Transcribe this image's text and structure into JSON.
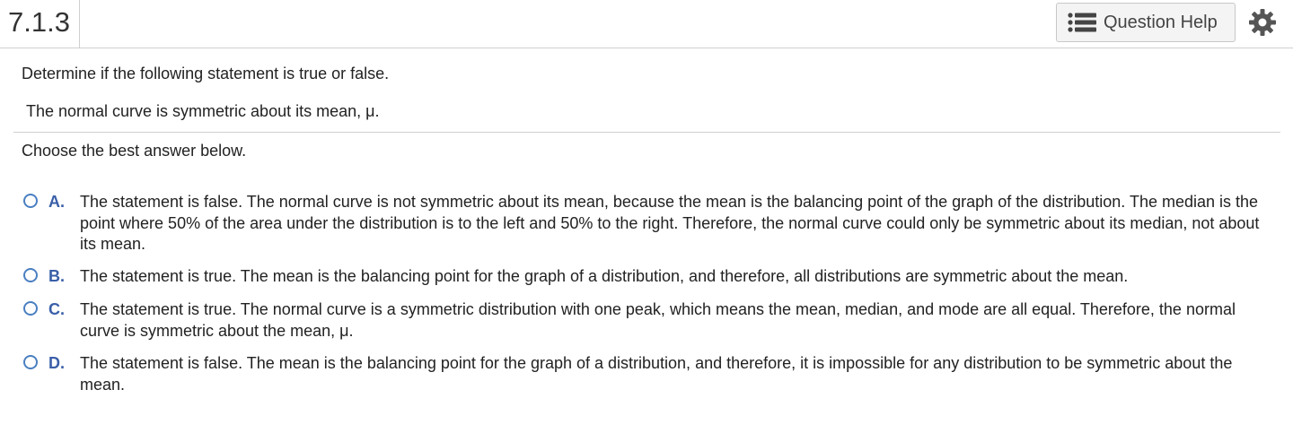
{
  "header": {
    "question_number": "7.1.3",
    "help_label": "Question Help",
    "help_icon": "list-icon",
    "settings_icon": "gear-icon"
  },
  "question": {
    "prompt": "Determine if the following statement is true or false.",
    "statement": "The normal curve is symmetric about its mean, μ.",
    "instruction": "Choose the best answer below."
  },
  "options": [
    {
      "letter": "A.",
      "text": "The statement is false. The normal curve is not symmetric about its mean, because the mean is the balancing point of the graph of the distribution. The median is the point where 50% of the area under the distribution is to the left and 50% to the right. Therefore, the normal curve could only be symmetric about its median, not about its mean."
    },
    {
      "letter": "B.",
      "text": "The statement is true. The mean is the balancing point for the graph of a distribution, and therefore, all distributions are symmetric about the mean."
    },
    {
      "letter": "C.",
      "text": "The statement is true. The normal curve is a symmetric distribution with one peak, which means the mean, median, and mode are all equal. Therefore, the normal curve is symmetric about the mean, μ."
    },
    {
      "letter": "D.",
      "text": "The statement is false. The mean is the balancing point for the graph of a distribution, and therefore, it is impossible for any distribution to be symmetric about the mean."
    }
  ],
  "colors": {
    "accent": "#3a5fa8",
    "radio_border": "#4a7fc1",
    "divider": "#cfcfcf"
  }
}
